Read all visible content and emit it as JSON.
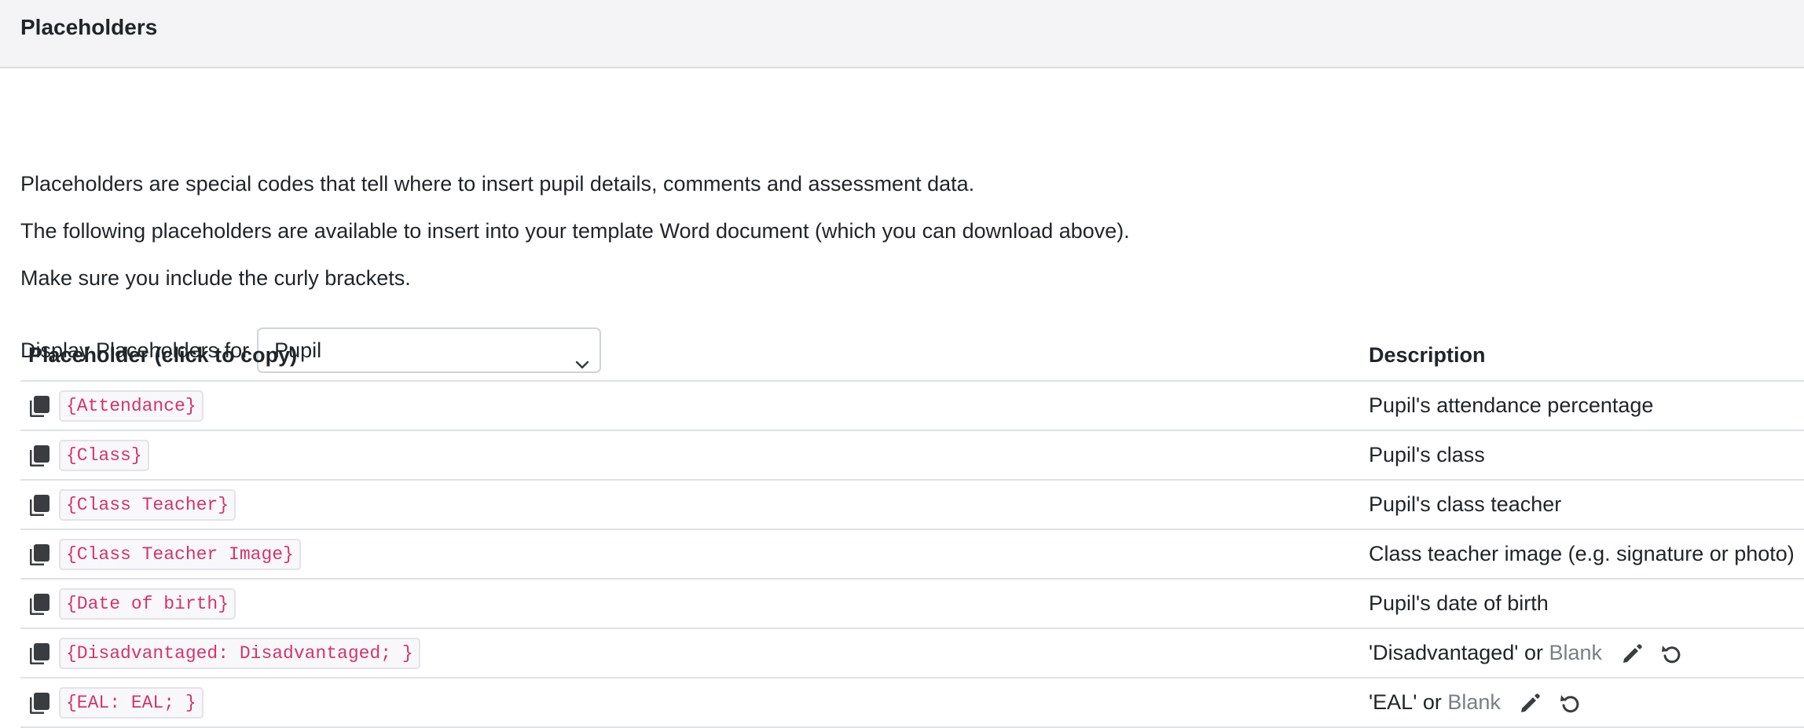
{
  "header": {
    "title": "Placeholders"
  },
  "intro": {
    "line1": "Placeholders are special codes that tell where to insert pupil details, comments and assessment data.",
    "line2": "The following placeholders are available to insert into your template Word document (which you can download above).",
    "line3": "Make sure you include the curly brackets."
  },
  "filter": {
    "label": "Display Placeholders for",
    "selected": "Pupil"
  },
  "table": {
    "headers": {
      "placeholder": "Placeholder (click to copy)",
      "description": "Description"
    },
    "rows": [
      {
        "code": "{Attendance}",
        "desc": "Pupil's attendance percentage"
      },
      {
        "code": "{Class}",
        "desc": "Pupil's class"
      },
      {
        "code": "{Class Teacher}",
        "desc": "Pupil's class teacher"
      },
      {
        "code": "{Class Teacher Image}",
        "desc": "Class teacher image (e.g. signature or photo)"
      },
      {
        "code": "{Date of birth}",
        "desc": "Pupil's date of birth"
      },
      {
        "code": "{Disadvantaged: Disadvantaged; }",
        "desc_quoted": "'Disadvantaged' or",
        "desc_blank": "Blank"
      },
      {
        "code": "{EAL: EAL; }",
        "desc_quoted": "'EAL' or",
        "desc_blank": "Blank"
      }
    ]
  },
  "icons": {
    "copy": "copy-icon",
    "edit": "pencil-icon",
    "reset": "undo-icon"
  },
  "colors": {
    "code_text": "#d6336c",
    "header_bg": "#f4f4f6",
    "muted": "#7a7f85"
  }
}
